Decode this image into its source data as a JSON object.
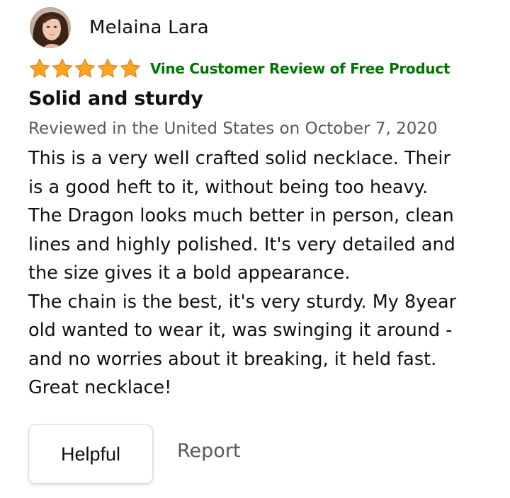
{
  "review": {
    "profile_name": "Melaina Lara",
    "rating": 5,
    "max_rating": 5,
    "vine_label": "Vine Customer Review of Free Product",
    "title": "Solid and sturdy",
    "date_line": "Reviewed in the United States on October 7, 2020",
    "body_lines": [
      "This is a very well crafted solid necklace. Their",
      "is a good heft to it, without being too heavy.",
      "The Dragon looks much better in person, clean",
      "lines and highly polished. It's very detailed and",
      "the size gives it a bold appearance.",
      "The chain is the best, it's very sturdy. My 8year",
      "old wanted to wear it, was swinging it around -",
      "and no worries about it breaking, it held fast.",
      "Great necklace!"
    ],
    "helpful_label": "Helpful",
    "report_label": "Report"
  },
  "colors": {
    "star": "#ffa41c",
    "star_outline": "#de7921",
    "vine": "#007600",
    "muted_text": "#565959"
  },
  "icons": {
    "avatar": "avatar",
    "star": "star-icon"
  }
}
